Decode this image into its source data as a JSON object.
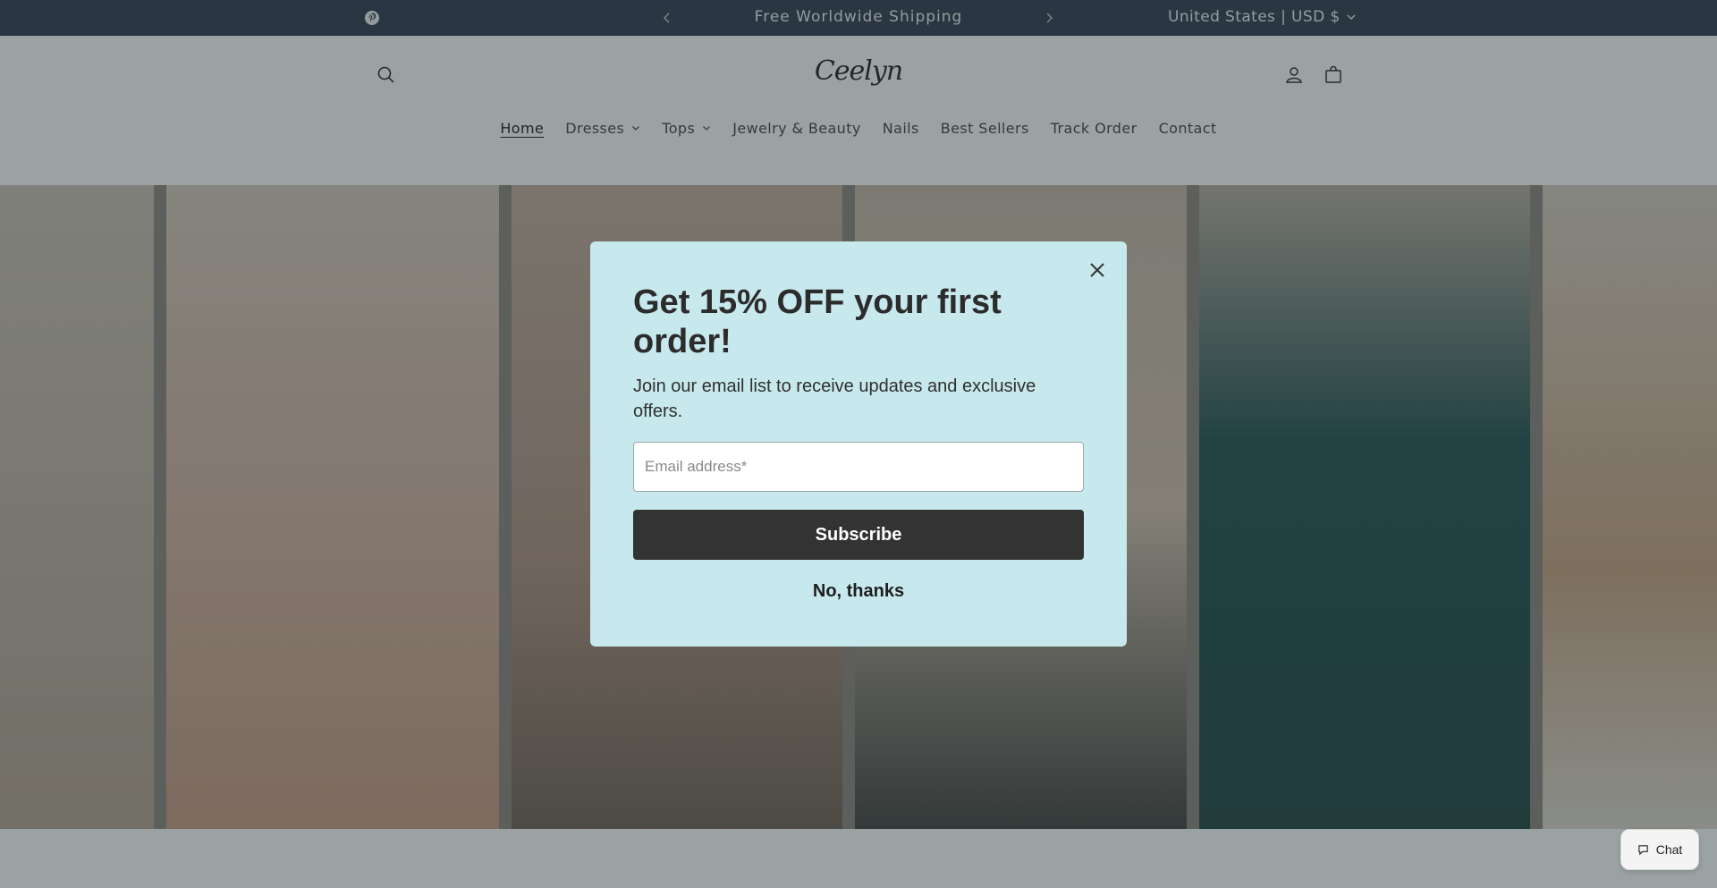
{
  "announcement": {
    "message": "Free Worldwide Shipping",
    "prev_icon": "chevron-left-icon",
    "next_icon": "chevron-right-icon",
    "locale": "United States | USD $",
    "social_icon": "pinterest-icon"
  },
  "header": {
    "logo_text": "Ceelyn",
    "icons": [
      "search-icon",
      "account-icon",
      "cart-icon"
    ]
  },
  "nav": {
    "items": [
      {
        "label": "Home",
        "active": true,
        "dropdown": false
      },
      {
        "label": "Dresses",
        "active": false,
        "dropdown": true
      },
      {
        "label": "Tops",
        "active": false,
        "dropdown": true
      },
      {
        "label": "Jewelry & Beauty",
        "active": false,
        "dropdown": false
      },
      {
        "label": "Nails",
        "active": false,
        "dropdown": false
      },
      {
        "label": "Best Sellers",
        "active": false,
        "dropdown": false
      },
      {
        "label": "Track Order",
        "active": false,
        "dropdown": false
      },
      {
        "label": "Contact",
        "active": false,
        "dropdown": false
      }
    ]
  },
  "popup": {
    "title": "Get 15% OFF your first order!",
    "description": "Join our email list to receive updates and exclusive offers.",
    "email_placeholder": "Email address*",
    "email_value": "",
    "subscribe_label": "Subscribe",
    "decline_label": "No, thanks",
    "background": "#c7e9ed"
  },
  "chat": {
    "label": "Chat"
  },
  "colors": {
    "announcement_bg": "#2d3446",
    "button_dark": "#333333"
  }
}
